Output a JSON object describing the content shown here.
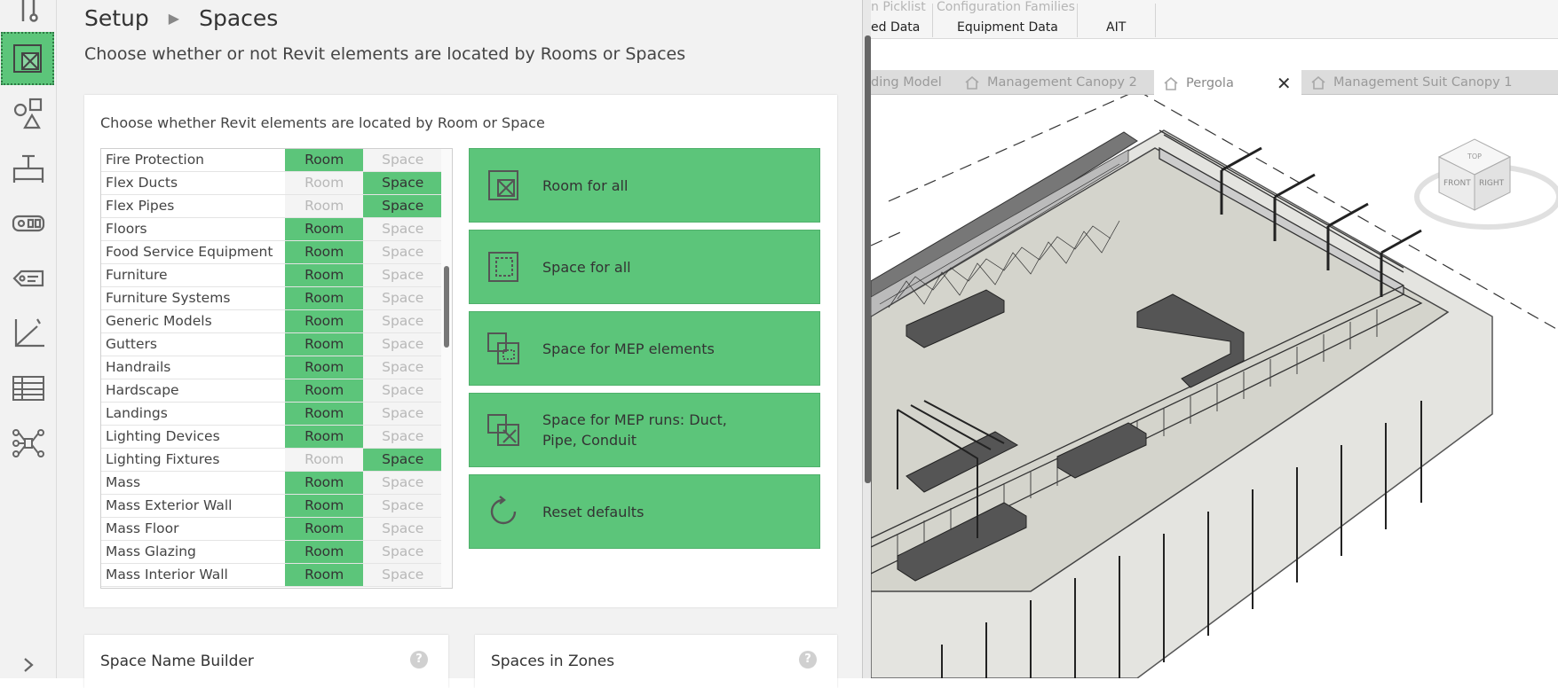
{
  "setup": {
    "breadcrumb_root": "Setup",
    "breadcrumb_sep": "▶",
    "breadcrumb_page": "Spaces",
    "subtitle": "Choose whether or not Revit elements are located by Rooms or Spaces",
    "card_title": "Choose whether Revit elements are located by Room or Space",
    "room_label": "Room",
    "space_label": "Space",
    "categories": [
      {
        "name": "Fire Protection",
        "selected": "Room"
      },
      {
        "name": "Flex Ducts",
        "selected": "Space"
      },
      {
        "name": "Flex Pipes",
        "selected": "Space"
      },
      {
        "name": "Floors",
        "selected": "Room"
      },
      {
        "name": "Food Service Equipment",
        "selected": "Room"
      },
      {
        "name": "Furniture",
        "selected": "Room"
      },
      {
        "name": "Furniture Systems",
        "selected": "Room"
      },
      {
        "name": "Generic Models",
        "selected": "Room"
      },
      {
        "name": "Gutters",
        "selected": "Room"
      },
      {
        "name": "Handrails",
        "selected": "Room"
      },
      {
        "name": "Hardscape",
        "selected": "Room"
      },
      {
        "name": "Landings",
        "selected": "Room"
      },
      {
        "name": "Lighting Devices",
        "selected": "Room"
      },
      {
        "name": "Lighting Fixtures",
        "selected": "Space"
      },
      {
        "name": "Mass",
        "selected": "Room"
      },
      {
        "name": "Mass Exterior Wall",
        "selected": "Room"
      },
      {
        "name": "Mass Floor",
        "selected": "Room"
      },
      {
        "name": "Mass Glazing",
        "selected": "Room"
      },
      {
        "name": "Mass Interior Wall",
        "selected": "Room"
      }
    ],
    "actions": [
      {
        "label": "Room for all",
        "icon": "room-icon"
      },
      {
        "label": "Space for all",
        "icon": "space-icon"
      },
      {
        "label": "Space for MEP elements",
        "icon": "mep-elements-icon"
      },
      {
        "label": "Space for MEP runs: Duct, Pipe, Conduit",
        "icon": "mep-runs-icon"
      },
      {
        "label": "Reset defaults",
        "icon": "reset-icon"
      }
    ],
    "space_name_builder": "Space Name Builder",
    "spaces_in_zones": "Spaces in Zones",
    "help_glyph": "?"
  },
  "rail": {
    "icons": [
      "sliders-icon",
      "room-space-icon",
      "shapes-icon",
      "equipment-icon",
      "tags-icon",
      "label-icon",
      "axis-chart-icon",
      "table-icon",
      "network-icon",
      "chevron-right-icon"
    ]
  },
  "revit": {
    "ribbon_faded_1": "n  Picklist",
    "ribbon_faded_2": "Configuration  Families",
    "ribbon_tab_1": "ed Data",
    "ribbon_tab_2": "Equipment Data",
    "ribbon_tab_3": "AIT",
    "view_tabs": [
      {
        "label": "ding Model"
      },
      {
        "label": "Management Canopy 2"
      },
      {
        "label": "Pergola",
        "active": true
      },
      {
        "label": "Management Suit Canopy 1"
      }
    ],
    "close_glyph": "✕",
    "viewcube_labels": [
      "TOP",
      "FRONT",
      "RIGHT"
    ]
  },
  "colors": {
    "accent_green": "#5cc57a",
    "panel_bg": "#f2f2f2"
  }
}
